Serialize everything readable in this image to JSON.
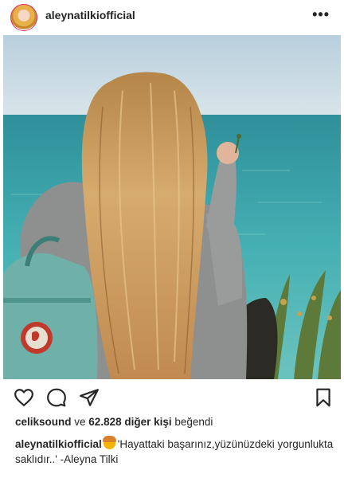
{
  "post": {
    "username": "aleynatilkiofficial",
    "more_icon": "•••"
  },
  "actions": {
    "like_icon": "heart-icon",
    "comment_icon": "comment-icon",
    "share_icon": "paper-plane-icon",
    "save_icon": "bookmark-icon"
  },
  "likes": {
    "first_liker": "celiksound",
    "connector": " ve ",
    "others": "62.828 diğer kişi",
    "suffix": " beğendi"
  },
  "caption": {
    "username": "aleynatilkiofficial",
    "emoji": "person-with-blond-hair-emoji",
    "text": "'Hayattaki başarınız,yüzünüzdeki yorgunlukta saklıdır..' -Aleyna Tilki"
  },
  "colors": {
    "sea": "#3fa7ad",
    "sky": "#c9dbe6",
    "hair": "#c9995c",
    "backpack": "#6fb1a9",
    "text": "#262626"
  }
}
